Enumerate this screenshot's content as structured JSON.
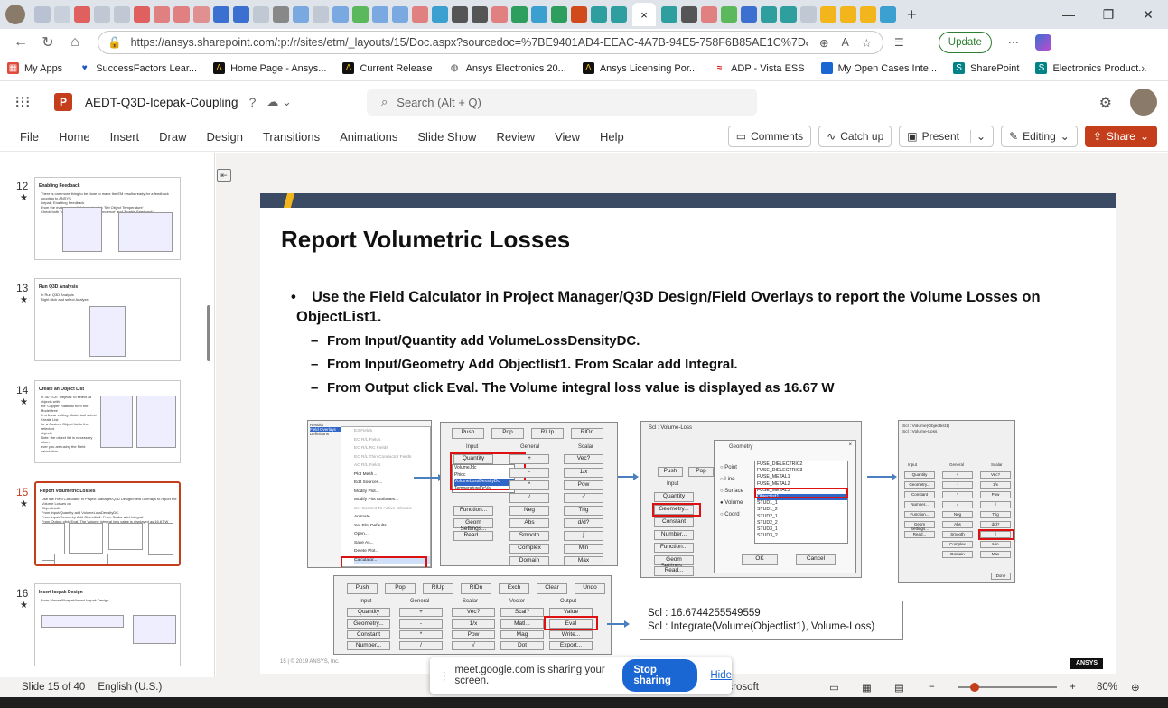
{
  "browser": {
    "active_tab_close": "×",
    "url": "https://ansys.sharepoint.com/:p:/r/sites/etm/_layouts/15/Doc.aspx?sourcedoc=%7BE9401AD4-EEAC-4A7B-94E5-758F6B85AE1C%7D&file=AEDT-Q3D-Icepak-...",
    "update_label": "Update",
    "bookmarks": [
      "My Apps",
      "SuccessFactors Lear...",
      "Home Page - Ansys...",
      "Current Release",
      "Ansys Electronics 20...",
      "Ansys Licensing Por...",
      "ADP - Vista ESS",
      "My Open Cases Inte...",
      "SharePoint",
      "Electronics Product..."
    ]
  },
  "app": {
    "doc_title": "AEDT-Q3D-Icepak-Coupling",
    "search_placeholder": "Search (Alt + Q)",
    "ribbon_tabs": [
      "File",
      "Home",
      "Insert",
      "Draw",
      "Design",
      "Transitions",
      "Animations",
      "Slide Show",
      "Review",
      "View",
      "Help"
    ],
    "comments_label": "Comments",
    "catchup_label": "Catch up",
    "present_label": "Present",
    "editing_label": "Editing",
    "share_label": "Share"
  },
  "thumbnails": [
    {
      "num": "12",
      "title": "Enabling Feedback",
      "lines": [
        "There is one more thing to be done to make the EM results ready for a feedback coupling to ANSYS",
        "Icepak, Enabling Feedback",
        "From the main menu click Icepak, click 'Set Object Temperature'",
        "Check both 'Include Temperature Dependence' and 'Enable Feedback'"
      ]
    },
    {
      "num": "13",
      "title": "Run Q3D Analysis",
      "lines": [
        "In Run Q3D Analysis",
        "Right click and select Analyze"
      ]
    },
    {
      "num": "14",
      "title": "Create an Object List",
      "lines": [
        "In 3D ECE 'Objects' to select all objects with",
        "the 'Copper' material from the Model tree",
        "In a linear editing Model tool select Create List",
        "for a Custom Object list to the selected",
        "objects",
        "Note: the object list is necessary when",
        "ever you are using the Field calculation"
      ]
    },
    {
      "num": "15",
      "title": "Report Volumetric Losses",
      "lines": [
        "Use the Field Calculator in Project Manager/Q3D Design/Field Overlays to report the Volume Losses on",
        "ObjectList1.",
        "From Input/Quantity add VolumeLossDensityDC.",
        "From Input/Geometry Add Objectlist1. From Scalar add Integral.",
        "From Output click Eval. The Volume integral loss value is displayed as 16.67 W"
      ]
    },
    {
      "num": "16",
      "title": "Insert Icepak Design",
      "lines": [
        "From Maxwell/Icepak/Insert Icepak Design"
      ]
    }
  ],
  "slide": {
    "title": "Report Volumetric Losses",
    "bullet": "Use the Field Calculator in Project Manager/Q3D Design/Field Overlays to report the Volume Losses on ObjectList1.",
    "subs": [
      "From Input/Quantity add VolumeLossDensityDC.",
      "From Input/Geometry Add Objectlist1. From Scalar add Integral.",
      "From Output click  Eval. The Volume integral loss value is displayed as 16.67 W"
    ],
    "footer": "© 2019 ANSYS, Inc.",
    "page_num": "15",
    "logo": "ANSYS",
    "result_line1": "Scl : 16.6744255549559",
    "result_line2": "Scl : Integrate(Volume(Objectlist1), Volume-Loss)",
    "menu_items": [
      "E3 Fields",
      "EC R/L Fields",
      "EC R/L RC Fields",
      "EC R/L Thin Conductor Fields",
      "AC R/L Fields",
      "Plot Mesh...",
      "Edit Sources...",
      "Modify Plot...",
      "Modify Plot Attributes...",
      "Set Context To Active Window",
      "Animate...",
      "Set Plot Defaults...",
      "Open...",
      "Save As...",
      "Delete Plot...",
      "Calculator..."
    ],
    "menu_tree": [
      "Results",
      "Field Overlays",
      "Definitions"
    ],
    "calc_headers": [
      "Input",
      "General",
      "Scalar"
    ],
    "calc_top": [
      "Push",
      "Pop",
      "RlUp",
      "RlDn"
    ],
    "calc_left": [
      "Quantity",
      "Geometry...",
      "Constant",
      "Number...",
      "Function...",
      "Geom Settings...",
      "Read..."
    ],
    "calc_mid": [
      "+",
      "-",
      "*",
      "/",
      "Neg",
      "Abs",
      "Smooth",
      "Complex",
      "Domain"
    ],
    "calc_right": [
      "Vec?",
      "1/x",
      "Pow",
      "√",
      "Trig",
      "d/d?",
      "∫",
      "Min",
      "Max"
    ],
    "quantity_list": [
      "VolumeJdc",
      "Phidc",
      "VolumeLossDensityDc",
      "TemperatureDcVal"
    ],
    "geo_dialog_title": "Geometry",
    "geo_options": [
      "Point",
      "Line",
      "Surface",
      "Volume",
      "Coord"
    ],
    "geo_list": [
      "FUSE_DIELECTRIC2",
      "FUSE_DIELECTRIC3",
      "FUSE_METAL1",
      "FUSE_METAL2",
      "FUSE_METAL3",
      "Objectlist1",
      "STUD1_1",
      "STUD1_2",
      "STUD2_1",
      "STUD2_2",
      "STUD3_1",
      "STUD3_2"
    ],
    "geo_ok": "OK",
    "geo_cancel": "Cancel",
    "scl_label": "Scl : Volume-Loss",
    "p3_header": "Scl : Volume(Objectlist1)\nScl : Volume-Loss",
    "p3_close": "Done",
    "bottom_top": [
      "Push",
      "Pop",
      "RlUp",
      "RlDn",
      "Exch",
      "Clear",
      "Undo"
    ],
    "bottom_headers": [
      "Input",
      "General",
      "Scalar",
      "Vector",
      "Output"
    ],
    "bottom_rows": [
      [
        "Quantity",
        "+",
        "Vec?",
        "Scal?",
        "Value"
      ],
      [
        "Geometry...",
        "-",
        "1/x",
        "Matl...",
        "Eval"
      ],
      [
        "Constant",
        "*",
        "Pow",
        "Mag",
        "Write..."
      ],
      [
        "Number...",
        "/",
        "√",
        "Dot",
        "Export..."
      ]
    ]
  },
  "share": {
    "message": "meet.google.com is sharing your screen.",
    "stop_label": "Stop sharing",
    "hide_label": "Hide"
  },
  "status": {
    "slide": "Slide 15 of 40",
    "language": "English (U.S.)",
    "feedback": "Give Feedback to Microsoft",
    "zoom": "80%"
  },
  "colors": {
    "accent": "#c43e1c",
    "slide_bar": "#3b4b63",
    "gold": "#f2b51c",
    "red_box": "#dd1111",
    "link_blue": "#1a66d2"
  }
}
